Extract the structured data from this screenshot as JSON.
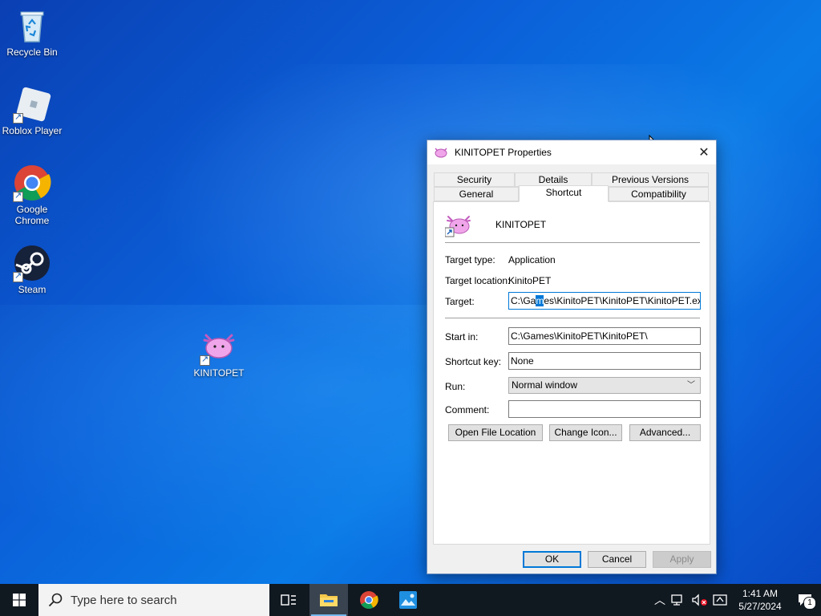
{
  "desktop": {
    "icons": [
      {
        "label": "Recycle Bin"
      },
      {
        "label": "Roblox Player"
      },
      {
        "label": "Google Chrome"
      },
      {
        "label": "Steam"
      },
      {
        "label": "KINITOPET"
      }
    ]
  },
  "dialog": {
    "title": "KINITOPET Properties",
    "tabs_row1": [
      "Security",
      "Details",
      "Previous Versions"
    ],
    "tabs_row2": [
      "General",
      "Shortcut",
      "Compatibility"
    ],
    "active_tab": "Shortcut",
    "app_name": "KINITOPET",
    "target_type_label": "Target type:",
    "target_type_value": "Application",
    "target_location_label": "Target location:",
    "target_location_value": "KinitoPET",
    "target_label": "Target:",
    "target_value_pre": "C:\\Ga",
    "target_value_sel": "m",
    "target_value_post": "es\\KinitoPET\\KinitoPET\\KinitoPET.exe",
    "start_in_label": "Start in:",
    "start_in_value": "C:\\Games\\KinitoPET\\KinitoPET\\",
    "shortcut_key_label": "Shortcut key:",
    "shortcut_key_value": "None",
    "run_label": "Run:",
    "run_value": "Normal window",
    "comment_label": "Comment:",
    "comment_value": "",
    "open_file_location": "Open File Location",
    "change_icon": "Change Icon...",
    "advanced": "Advanced...",
    "ok": "OK",
    "cancel": "Cancel",
    "apply": "Apply"
  },
  "taskbar": {
    "search_placeholder": "Type here to search",
    "time": "1:41 AM",
    "date": "5/27/2024",
    "notification_count": "1"
  },
  "colors": {
    "accent": "#0078d7",
    "taskbar": "#101820"
  }
}
